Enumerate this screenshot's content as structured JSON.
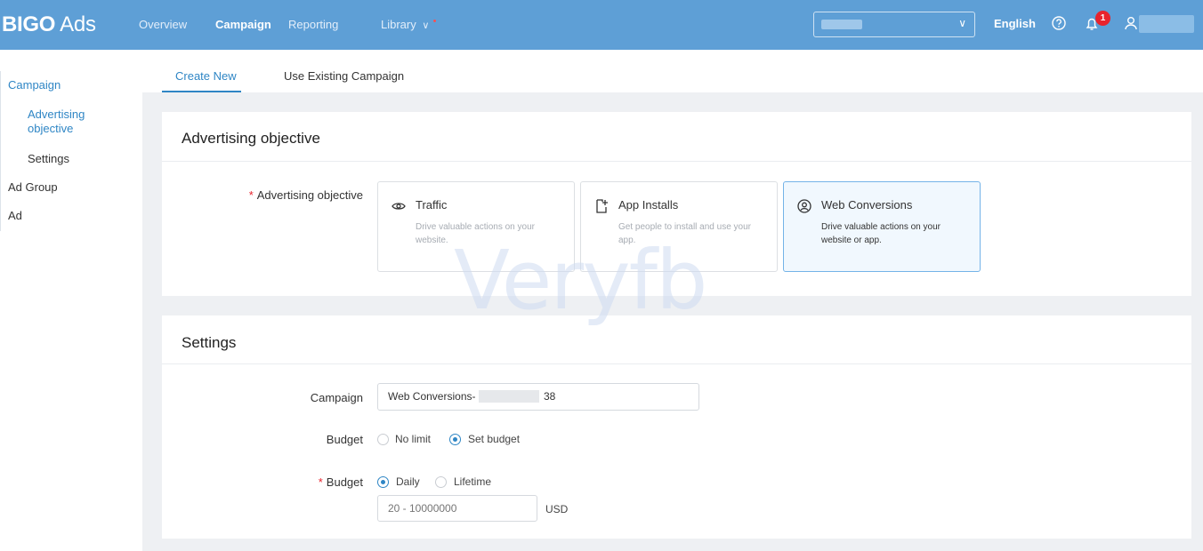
{
  "app": {
    "logo_bold": "BIGO",
    "logo_rest": " Ads"
  },
  "nav": {
    "overview": "Overview",
    "campaign": "Campaign",
    "reporting": "Reporting",
    "library": "Library",
    "library_chevron": "∨",
    "library_dot": "•"
  },
  "header": {
    "account_chevron": "∨",
    "language": "English",
    "notification_count": "1"
  },
  "sidebar": {
    "campaign": "Campaign",
    "advertising_objective": "Advertising objective",
    "settings": "Settings",
    "ad_group": "Ad Group",
    "ad": "Ad"
  },
  "tabs": {
    "create_new": "Create New",
    "use_existing": "Use Existing Campaign"
  },
  "objective_section": {
    "title": "Advertising objective",
    "label": "Advertising objective",
    "required_mark": "*",
    "options": [
      {
        "icon": "eye-icon",
        "title": "Traffic",
        "desc": "Drive valuable actions on your website."
      },
      {
        "icon": "app-install-icon",
        "title": "App Installs",
        "desc": "Get people to install and use your app."
      },
      {
        "icon": "web-conversions-icon",
        "title": "Web Conversions",
        "desc": "Drive valuable actions on your website or app.",
        "selected": true
      }
    ]
  },
  "settings_section": {
    "title": "Settings",
    "campaign_label": "Campaign",
    "campaign_value_prefix": "Web Conversions-",
    "campaign_value_suffix": "38",
    "budget_label": "Budget",
    "budget_options": {
      "no_limit": "No limit",
      "set_budget": "Set budget"
    },
    "budget2_label": "Budget",
    "required_mark": "*",
    "budget_type": {
      "daily": "Daily",
      "lifetime": "Lifetime"
    },
    "budget_placeholder": "20 - 10000000",
    "currency": "USD"
  },
  "watermark": "Veryfb",
  "colors": {
    "header": "#5e9fd6",
    "accent": "#2f86c5",
    "required": "#e8232d"
  }
}
